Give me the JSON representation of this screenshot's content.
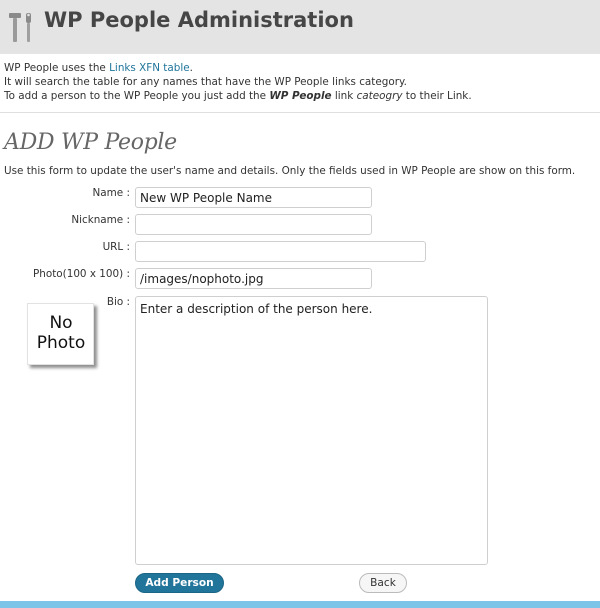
{
  "header": {
    "title": "WP People Administration",
    "icon": "tools-icon"
  },
  "intro": {
    "line1_prefix": "WP People uses the ",
    "line1_link": "Links XFN table",
    "line1_suffix": ".",
    "line2": "It will search the table for any names that have the WP People links category.",
    "line3_prefix": "To add a person to the WP People you just add the ",
    "line3_bold": "WP People",
    "line3_mid": " link ",
    "line3_italic": "cateogry",
    "line3_suffix": " to their Link."
  },
  "form": {
    "title": "ADD WP People",
    "description": "Use this form to update the user's name and details. Only the fields used in WP People are show on this form.",
    "fields": {
      "name": {
        "label": "Name :",
        "value": "New WP People Name"
      },
      "nickname": {
        "label": "Nickname :",
        "value": ""
      },
      "url": {
        "label": "URL :",
        "value": ""
      },
      "photo": {
        "label": "Photo(100 x 100) :",
        "value": "/images/nophoto.jpg"
      },
      "bio": {
        "label": "Bio :",
        "value": "Enter a description of the person here."
      }
    },
    "photo_placeholder": {
      "line1": "No",
      "line2": "Photo"
    },
    "buttons": {
      "add": "Add Person",
      "back": "Back"
    }
  },
  "colors": {
    "header_bg": "#e4e4e4",
    "link": "#21759b",
    "primary_button": "#21759b",
    "footer_bar": "#7ec4e8"
  }
}
